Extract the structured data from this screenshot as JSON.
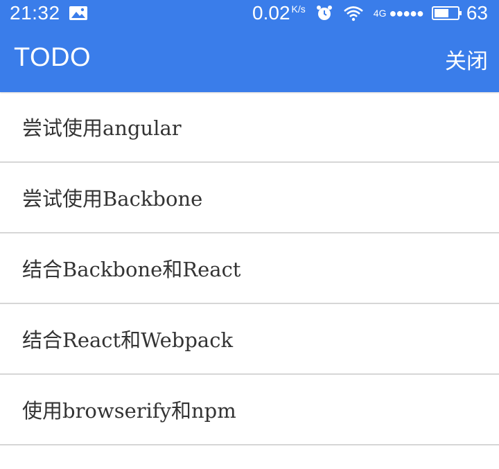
{
  "status_bar": {
    "time": "21:32",
    "image_icon": "image-icon",
    "net_speed": "0.02",
    "net_speed_unit": "K/s",
    "alarm_icon": "alarm-clock-icon",
    "wifi_icon": "wifi-icon",
    "network_type": "4G",
    "signal_dots": "●●●●●",
    "battery_level": 0.63,
    "battery_percent": "63"
  },
  "app_bar": {
    "title": "TODO",
    "close_label": "关闭",
    "color": "#3a7dea"
  },
  "todos": [
    {
      "label": "尝试使用angular"
    },
    {
      "label": "尝试使用Backbone"
    },
    {
      "label": "结合Backbone和React"
    },
    {
      "label": "结合React和Webpack"
    },
    {
      "label": "使用browserify和npm"
    }
  ]
}
